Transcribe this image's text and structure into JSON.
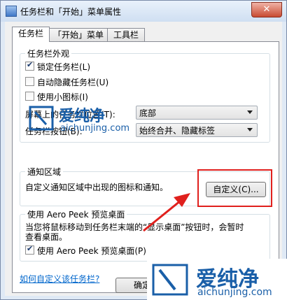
{
  "window": {
    "title": "任务栏和「开始」菜单属性",
    "close_symbol": "✕"
  },
  "tabs": [
    {
      "label": "任务栏"
    },
    {
      "label": "「开始」菜单"
    },
    {
      "label": "工具栏"
    }
  ],
  "appearance": {
    "legend": "任务栏外观",
    "options": [
      {
        "label": "锁定任务栏(L)",
        "checked": true
      },
      {
        "label": "自动隐藏任务栏(U)",
        "checked": false
      },
      {
        "label": "使用小图标(I)",
        "checked": false
      }
    ],
    "position": {
      "label": "屏幕上的任务栏位置(T):",
      "value": "底部"
    },
    "buttons": {
      "label": "任务栏按钮(B):",
      "value": "始终合并、隐藏标签"
    }
  },
  "notification": {
    "legend": "通知区域",
    "description": "自定义通知区域中出现的图标和通知。",
    "customize_label": "自定义(C)..."
  },
  "aero": {
    "legend": "使用 Aero Peek 预览桌面",
    "description_1": "当您将鼠标移动到任务栏末端的“显示桌面”按钮时，会暂时",
    "description_2": "查看桌面。",
    "option": {
      "label": "使用 Aero Peek 预览桌面(P)",
      "checked": true
    }
  },
  "help_link": "如何自定义该任务栏?",
  "footer": {
    "ok_label": "确定"
  },
  "watermark": {
    "brand": "爱纯净",
    "site": "aichunjing.com"
  },
  "colors": {
    "highlight": "#e0201d",
    "link": "#0066cc",
    "watermark": "#1a5fa8"
  }
}
